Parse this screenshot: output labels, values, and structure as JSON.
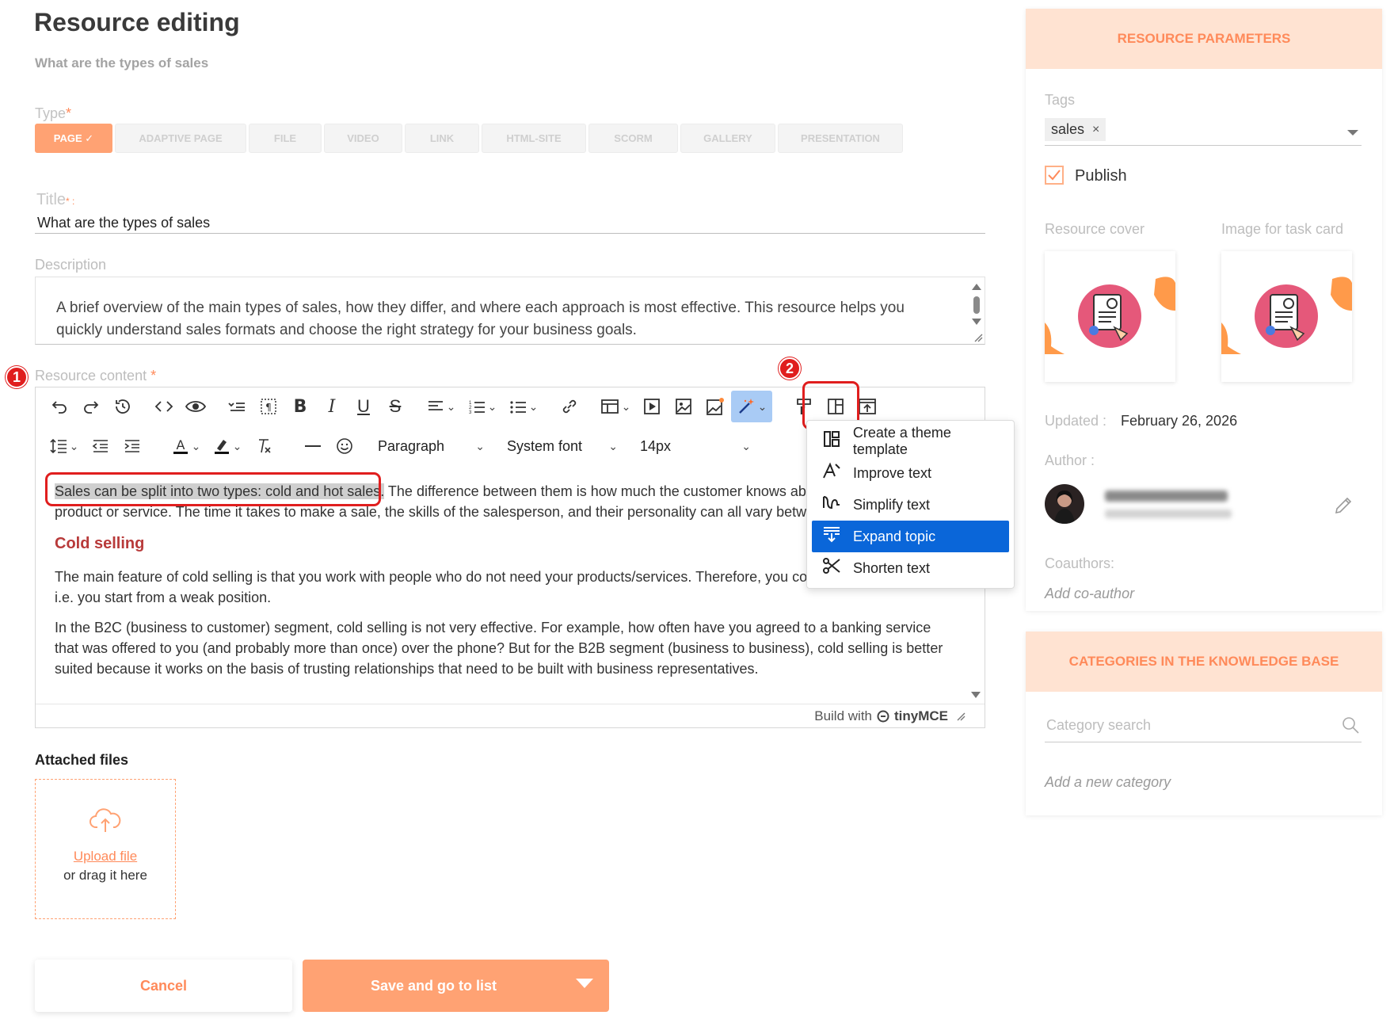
{
  "page": {
    "title": "Resource editing",
    "subtitle": "What are the types of sales"
  },
  "type_field": {
    "label": "Type",
    "required_mark": "*",
    "tabs": [
      {
        "label": "PAGE ✓",
        "active": true
      },
      {
        "label": "ADAPTIVE PAGE",
        "active": false
      },
      {
        "label": "FILE",
        "active": false
      },
      {
        "label": "VIDEO",
        "active": false
      },
      {
        "label": "LINK",
        "active": false
      },
      {
        "label": "HTML-SITE",
        "active": false
      },
      {
        "label": "SCORM",
        "active": false
      },
      {
        "label": "GALLERY",
        "active": false
      },
      {
        "label": "PRESENTATION",
        "active": false
      }
    ]
  },
  "title_field": {
    "label": "Title",
    "required_mark": "* :",
    "value": "What are the types of sales"
  },
  "description_field": {
    "label": "Description",
    "value": "A brief overview of the main types of sales, how they differ, and where each approach is most effective. This resource helps you quickly understand sales formats and choose the right strategy for your business goals."
  },
  "resource_content": {
    "label": "Resource content",
    "required_mark": "*",
    "badge_1": "1",
    "badge_2": "2",
    "toolbar": {
      "block_format": "Paragraph",
      "font_family": "System font",
      "font_size": "14px"
    },
    "paragraphs": {
      "p1_highlight": "Sales can be split into two types: cold and hot sales.",
      "p1_rest": " The difference between them is how much the customer knows about about your product or service. The time it takes to make a sale, the skills of the salesperson, and their personality can all vary between these types.",
      "heading": "Cold selling",
      "p2": "The main feature of cold selling is that you work with people who do not need your products/services. Therefore, you come to them yourself, i.e. you start from a weak position.",
      "p3": "In the B2C (business to customer) segment, cold selling is not very effective. For example, how often have you agreed to a banking service that was offered to you (and probably more than once) over the phone? But for the B2B segment (business to business), cold selling is better suited because it works on the basis of trusting relationships that need to be built with business representatives."
    },
    "statusbar": {
      "build_with": "Build with",
      "brand": "tinyMCE"
    },
    "ai_menu": {
      "items": [
        {
          "label": "Create a theme template",
          "icon": "template-icon"
        },
        {
          "label": "Improve text",
          "icon": "improve-text-icon"
        },
        {
          "label": "Simplify text",
          "icon": "simplify-text-icon"
        },
        {
          "label": "Expand topic",
          "icon": "expand-topic-icon",
          "selected": true
        },
        {
          "label": "Shorten text",
          "icon": "scissors-icon"
        }
      ]
    }
  },
  "attachments": {
    "title": "Attached files",
    "upload_link": "Upload file",
    "drag_text": "or drag it here"
  },
  "actions": {
    "cancel": "Cancel",
    "save": "Save and go to list"
  },
  "resource_parameters": {
    "header": "RESOURCE PARAMETERS",
    "tags_label": "Tags",
    "tags": [
      "sales"
    ],
    "publish_label": "Publish",
    "publish_checked": true,
    "cover_label": "Resource cover",
    "task_card_label": "Image for task card",
    "updated_label": "Updated :",
    "updated_value": "February 26, 2026",
    "author_label": "Author :",
    "coauthors_label": "Coauthors:",
    "add_coauthor": "Add co-author"
  },
  "categories": {
    "header": "CATEGORIES IN THE KNOWLEDGE BASE",
    "search_placeholder": "Category search",
    "add_category": "Add a new category"
  },
  "colors": {
    "accent": "#ffa273",
    "accent_text": "#ff8a5a",
    "panel_header_bg": "#ffe3d2",
    "menu_selected": "#0a66d9",
    "annotation_red": "#e01e1e"
  }
}
